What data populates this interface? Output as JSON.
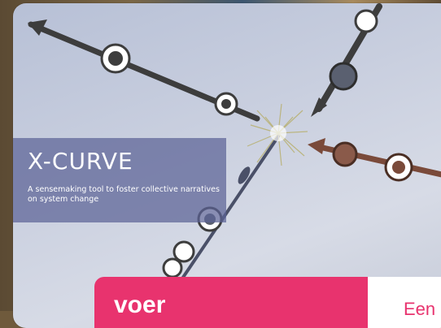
{
  "card": {
    "title": "X-CURVE",
    "subtitle": "A sensemaking tool to foster collective narratives on system change"
  },
  "tabs": [
    {
      "label": "voer",
      "color": "#e8336e"
    },
    {
      "label": "Een",
      "color": "#e8336e"
    }
  ],
  "colors": {
    "title_box": "#5c6296",
    "pink_accent": "#e8336e",
    "arrow_dark": "#3d3d3d",
    "arrow_brown": "#7a4a3a"
  },
  "icons": [
    "x-curve-illustration"
  ]
}
